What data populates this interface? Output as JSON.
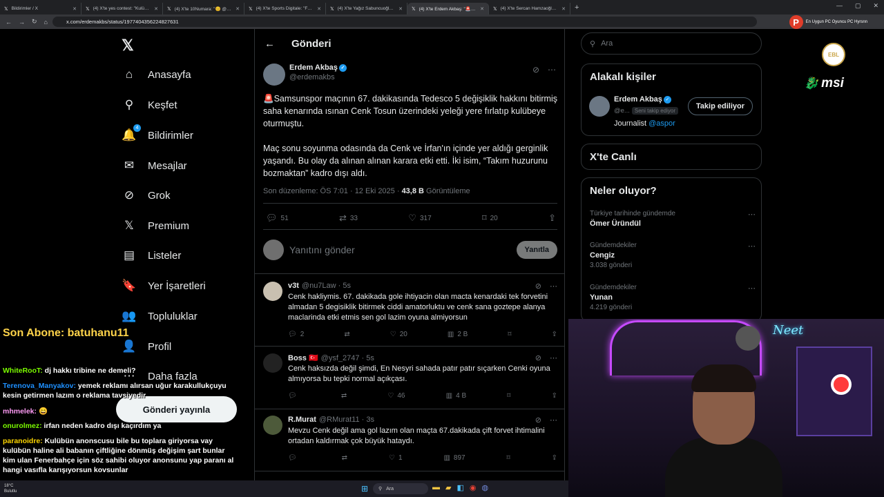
{
  "browser": {
    "tabs": [
      {
        "title": "Bildirimler / X",
        "active": false
      },
      {
        "title": "(4) X'te yes contest: \"Kulübün a",
        "active": false
      },
      {
        "title": "(4) X'te 10Numara: \"😊 @Rezz",
        "active": false
      },
      {
        "title": "(4) X'te Sports Digitale: \"Fenert",
        "active": false
      },
      {
        "title": "(4) X'te Yağız Sabuncuoğlu: \"Cs",
        "active": false
      },
      {
        "title": "(4) X'te Erdem Akbaş: \"🚨 Sams",
        "active": true
      },
      {
        "title": "(4) X'te Sercan Hamzaoğlu: \"Cs",
        "active": false
      }
    ],
    "url": "x.com/erdemakbs/status/1977404356224827631",
    "profile_initial": "P",
    "profile_label": "En Uygun PC Oyuncu PC Hyrsnn"
  },
  "nav": {
    "items": [
      {
        "label": "Anasayfa",
        "icon": "home-icon",
        "glyph": "⌂"
      },
      {
        "label": "Keşfet",
        "icon": "search-icon",
        "glyph": "⚲"
      },
      {
        "label": "Bildirimler",
        "icon": "bell-icon",
        "glyph": "🔔",
        "badge": "4"
      },
      {
        "label": "Mesajlar",
        "icon": "mail-icon",
        "glyph": "✉"
      },
      {
        "label": "Grok",
        "icon": "grok-icon",
        "glyph": "⊘"
      },
      {
        "label": "Premium",
        "icon": "x-premium-icon",
        "glyph": "𝕏"
      },
      {
        "label": "Listeler",
        "icon": "list-icon",
        "glyph": "▤"
      },
      {
        "label": "Yer İşaretleri",
        "icon": "bookmark-icon",
        "glyph": "🔖"
      },
      {
        "label": "Topluluklar",
        "icon": "communities-icon",
        "glyph": "👥"
      },
      {
        "label": "Profil",
        "icon": "profile-icon",
        "glyph": "👤"
      },
      {
        "label": "Daha fazla",
        "icon": "more-icon",
        "glyph": "⋯"
      }
    ],
    "post_button": "Gönderi yayınla"
  },
  "main": {
    "header_title": "Gönderi",
    "post": {
      "author_name": "Erdem Akbaş",
      "author_handle": "@erdemakbs",
      "paragraph1": "Samsunspor maçının 67. dakikasında Tedesco 5 değişiklik hakkını bitirmiş saha kenarında ısınan Cenk Tosun üzerindeki yeleği yere fırlatıp kulübeye oturmuştu.",
      "paragraph2": "Maç sonu soyunma odasında da Cenk ve İrfan'ın içinde yer aldığı gerginlik yaşandı. Bu olay da alınan alınan karara etki etti. İki isim, “Takım huzurunu bozmaktan” kadro dışı aldı.",
      "edited": "Son düzenleme: ÖS 7:01 · 12 Eki 2025 · ",
      "views": "43,8 B",
      "views_label": "Görüntüleme",
      "replies": "51",
      "reposts": "33",
      "likes": "317",
      "bookmarks": "20"
    },
    "reply_placeholder": "Yanıtını gönder",
    "reply_button": "Yanıtla",
    "replies": [
      {
        "name": "v3t",
        "handle": "@nu7Law · 5s",
        "text": "Cenk hakliymis. 67. dakikada gole ihtiyacin olan macta kenardaki tek forvetini almadan 5 degisiklik bitirmek ciddi amatorluktu ve cenk sana goztepe alanya maclarinda etki etmis sen gol lazim oyuna almiyorsun",
        "replies": "2",
        "reposts": "",
        "likes": "20",
        "views": "2 B"
      },
      {
        "name": "Boss 🇹🇷",
        "handle": "@ysf_2747 · 5s",
        "text": "Cenk haksızda değil şimdi, En Nesyri sahada patır patır sıçarken Cenki oyuna almıyorsa bu tepki normal açıkçası.",
        "replies": "",
        "reposts": "",
        "likes": "46",
        "views": "4 B"
      },
      {
        "name": "R.Murat",
        "handle": "@RMurat11 · 3s",
        "text": "Mevzu Cenk değil ama gol lazım olan maçta 67.dakikada çift forvet ihtimalini ortadan kaldırmak çok büyük hatay­dı.",
        "replies": "",
        "reposts": "",
        "likes": "1",
        "views": "897"
      }
    ]
  },
  "right": {
    "search_placeholder": "Ara",
    "related_title": "Alakalı kişiler",
    "related_person": {
      "name": "Erdem Akbaş",
      "handle": "@e...",
      "follows_you": "Seni takip ediyor",
      "button": "Takip ediliyor",
      "bio_prefix": "Journalist ",
      "bio_link": "@aspor"
    },
    "live_title": "X'te Canlı",
    "trends_title": "Neler oluyor?",
    "trends": [
      {
        "context": "Türkiye tarihinde gündemde",
        "title": "Ömer Üründül",
        "posts": ""
      },
      {
        "context": "Gündemdekiler",
        "title": "Cengiz",
        "posts": "3.038 gönderi"
      },
      {
        "context": "Gündemdekiler",
        "title": "Yunan",
        "posts": "4.219 gönderi"
      }
    ]
  },
  "overlay": {
    "last_sub": "Son Abone: batuhanu11",
    "chat": [
      {
        "user": "WhiteRooT:",
        "msg": " dj hakkı tribine ne demeli?",
        "color": "#7CFC00"
      },
      {
        "user": "Terenova_Manyakov:",
        "msg": " yemek reklamı alırsan uğur karakullukçuyu kesin getirmen lazım o reklama tavsiyedir",
        "color": "#1E90FF"
      },
      {
        "user": "mhmelek:",
        "msg": " 😄",
        "color": "#ff9bf5"
      },
      {
        "user": "onurolmez:",
        "msg": " irfan neden kadro dışı kaçırdım ya",
        "color": "#7CFC00"
      },
      {
        "user": "paranoidre:",
        "msg": " Kulübün anonscusu bile bu toplara giriyorsa vay kulübün haline ali babanın çiftliğine dönmüş değişim şart bunlar kim ulan Fenerbahçe için söz sahibi oluyor anonsunu yap paranı al hangi vasıfla karışıyorsun kovsunlar",
        "color": "#FFD700"
      }
    ],
    "sponsor_logo1": "EBL",
    "sponsor_logo2": "msi",
    "neon_sign": "Neet"
  },
  "taskbar": {
    "weather": "18°C\nBulutlu",
    "search": "Ara"
  },
  "colors": {
    "accent": "#1d9bf0",
    "background": "#000000",
    "border": "#2f3336",
    "muted": "#71767b"
  }
}
